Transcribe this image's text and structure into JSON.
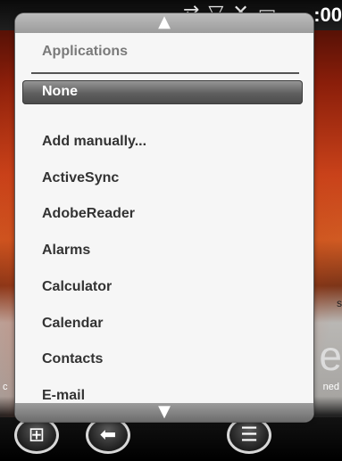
{
  "status": {
    "clock": ":00",
    "icons": [
      "connectivity-icon",
      "signal-icon",
      "mute-icon",
      "battery-icon"
    ]
  },
  "background_text": {
    "right_fragment_1": "s",
    "right_fragment_2": "ned",
    "left_fragment": "c",
    "right_glyph": "e"
  },
  "popup": {
    "section_title": "Applications",
    "selected_item": "None",
    "items": [
      "Add manually...",
      "ActiveSync",
      "AdobeReader",
      "Alarms",
      "Calculator",
      "Calendar",
      "Contacts",
      "E-mail"
    ]
  },
  "taskbar": {
    "start_icon": "windows-start-icon",
    "back_icon": "back-arrow-icon",
    "menu_icon": "menu-list-icon"
  },
  "colors": {
    "popup_bg": "#f6f6f6",
    "selected_bg": "#5f5f5f",
    "text": "#333333"
  }
}
